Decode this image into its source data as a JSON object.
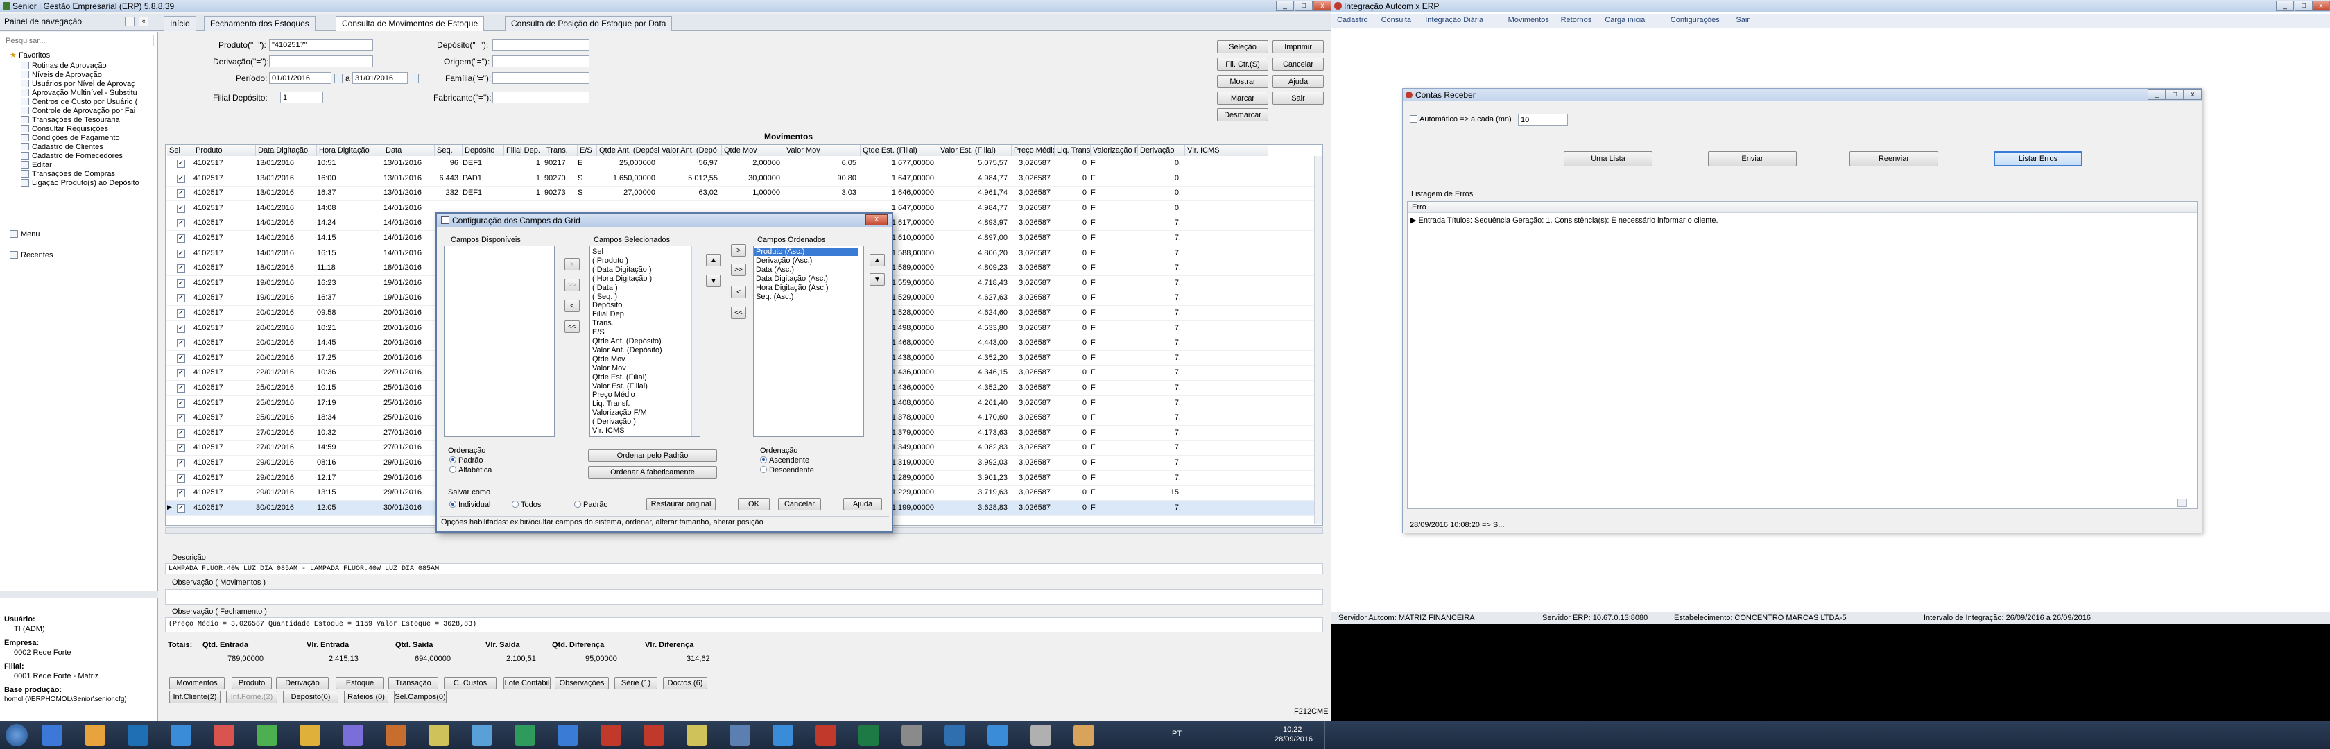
{
  "erp": {
    "title": "Senior | Gestão Empresarial (ERP) 5.8.8.39",
    "nav_panel_label": "Painel de navegação",
    "tabs": [
      "Início",
      "Fechamento dos Estoques",
      "Consulta de Movimentos de Estoque",
      "Consulta de Posição do Estoque por Data"
    ],
    "search_placeholder": "Pesquisar...",
    "favorites_label": "Favoritos",
    "favorites": [
      "Rotinas de Aprovação",
      "Níveis de Aprovação",
      "Usuários por Nível de Aprovaç",
      "Aprovação Multinível - Substitu",
      "Centros de Custo por Usuário (",
      "Controle de Aprovação por Fai",
      "Transações de Tesouraria",
      "Consultar Requisições",
      "Condições de Pagamento",
      "Cadastro de Clientes",
      "Cadastro de Fornecedores",
      "Editar",
      "Transações de Compras",
      "Ligação Produto(s) ao Depósito"
    ],
    "menu_label": "Menu",
    "recentes_label": "Recentes",
    "user_info": {
      "usuario_label": "Usuário:",
      "usuario": "TI (ADM)",
      "empresa_label": "Empresa:",
      "empresa": "0002 Rede Forte",
      "filial_label": "Filial:",
      "filial": "0001 Rede Forte - Matriz",
      "base_label": "Base produção:",
      "base": "homol (\\\\ERPHOMOL\\Senior\\senior.cfg)"
    },
    "filters": {
      "produto_label": "Produto(\"=\"):",
      "produto_value": "\"4102517\"",
      "derivacao_label": "Derivação(\"=\"):",
      "derivacao_value": "",
      "periodo_label": "Período:",
      "periodo_from": "01/01/2016",
      "periodo_sep": "a",
      "periodo_to": "31/01/2016",
      "filial_label": "Filial Depósito:",
      "filial_value": "1",
      "deposito_label": "Depósito(\"=\"):",
      "origem_label": "Origem(\"=\"):",
      "familia_label": "Família(\"=\"):",
      "fabricante_label": "Fabricante(\"=\"):"
    },
    "action_buttons": [
      "Seleção",
      "Imprimir",
      "Fil. Ctr.(S)",
      "Cancelar",
      "Mostrar",
      "Ajuda",
      "Marcar",
      "Sair",
      "Desmarcar"
    ],
    "movimentos_title": "Movimentos",
    "grid_headers": [
      "Sel",
      "Produto",
      "Data Digitação",
      "Hora Digitação",
      "Data",
      "Seq.",
      "Depósito",
      "Filial Dep.",
      "Trans.",
      "E/S",
      "Qtde Ant. (Depósito)",
      "Valor Ant. (Depó",
      "Qtde Mov",
      "Valor Mov",
      "Qtde Est. (Filial)",
      "Valor Est. (Filial)",
      "Preço Médio",
      "Liq. Transf.",
      "Valorização F/M",
      "Derivação",
      "Vlr. ICMS"
    ],
    "grid_rows": [
      [
        "4102517",
        "13/01/2016",
        "10:51",
        "13/01/2016",
        "96",
        "DEF1",
        "1",
        "90217",
        "E",
        "25,000000",
        "56,97",
        "2,00000",
        "6,05",
        "1.677,00000",
        "5.075,57",
        "3,026587",
        "0",
        "F",
        "0,"
      ],
      [
        "4102517",
        "13/01/2016",
        "16:00",
        "13/01/2016",
        "6.443",
        "PAD1",
        "1",
        "90270",
        "S",
        "1.650,00000",
        "5.012,55",
        "30,00000",
        "90,80",
        "1.647,00000",
        "4.984,77",
        "3,026587",
        "0",
        "F",
        "0,"
      ],
      [
        "4102517",
        "13/01/2016",
        "16:37",
        "13/01/2016",
        "232",
        "DEF1",
        "1",
        "90273",
        "S",
        "27,00000",
        "63,02",
        "1,00000",
        "3,03",
        "1.646,00000",
        "4.961,74",
        "3,026587",
        "0",
        "F",
        "0,"
      ],
      [
        "4102517",
        "14/01/2016",
        "14:08",
        "14/01/2016",
        "",
        "",
        "",
        "",
        "",
        "",
        "",
        "",
        "",
        "1.647,00000",
        "4.984,77",
        "3,026587",
        "0",
        "F",
        "0,"
      ],
      [
        "4102517",
        "14/01/2016",
        "14:24",
        "14/01/2016",
        "",
        "",
        "",
        "",
        "",
        "",
        "",
        "",
        "",
        "1.617,00000",
        "4.893,97",
        "3,026587",
        "0",
        "F",
        "7,"
      ],
      [
        "4102517",
        "14/01/2016",
        "14:15",
        "14/01/2016",
        "",
        "",
        "",
        "",
        "",
        "",
        "",
        "",
        "",
        "1.610,00000",
        "4.897,00",
        "3,026587",
        "0",
        "F",
        "7,"
      ],
      [
        "4102517",
        "14/01/2016",
        "16:15",
        "14/01/2016",
        "",
        "",
        "",
        "",
        "",
        "",
        "",
        "",
        "",
        "1.588,00000",
        "4.806,20",
        "3,026587",
        "0",
        "F",
        "7,"
      ],
      [
        "4102517",
        "18/01/2016",
        "11:18",
        "18/01/2016",
        "",
        "",
        "",
        "",
        "",
        "",
        "",
        "",
        "",
        "1.589,00000",
        "4.809,23",
        "3,026587",
        "0",
        "F",
        "7,"
      ],
      [
        "4102517",
        "19/01/2016",
        "16:23",
        "19/01/2016",
        "",
        "",
        "",
        "",
        "",
        "",
        "",
        "",
        "",
        "1.559,00000",
        "4.718,43",
        "3,026587",
        "0",
        "F",
        "7,"
      ],
      [
        "4102517",
        "19/01/2016",
        "16:37",
        "19/01/2016",
        "",
        "",
        "",
        "",
        "",
        "",
        "",
        "",
        "",
        "1.529,00000",
        "4.627,63",
        "3,026587",
        "0",
        "F",
        "7,"
      ],
      [
        "4102517",
        "20/01/2016",
        "09:58",
        "20/01/2016",
        "",
        "",
        "",
        "",
        "",
        "",
        "",
        "",
        "",
        "1.528,00000",
        "4.624,60",
        "3,026587",
        "0",
        "F",
        "7,"
      ],
      [
        "4102517",
        "20/01/2016",
        "10:21",
        "20/01/2016",
        "",
        "",
        "",
        "",
        "",
        "",
        "",
        "",
        "",
        "1.498,00000",
        "4.533,80",
        "3,026587",
        "0",
        "F",
        "7,"
      ],
      [
        "4102517",
        "20/01/2016",
        "14:45",
        "20/01/2016",
        "",
        "",
        "",
        "",
        "",
        "",
        "",
        "",
        "",
        "1.468,00000",
        "4.443,00",
        "3,026587",
        "0",
        "F",
        "7,"
      ],
      [
        "4102517",
        "20/01/2016",
        "17:25",
        "20/01/2016",
        "",
        "",
        "",
        "",
        "",
        "",
        "",
        "",
        "",
        "1.438,00000",
        "4.352,20",
        "3,026587",
        "0",
        "F",
        "7,"
      ],
      [
        "4102517",
        "22/01/2016",
        "10:36",
        "22/01/2016",
        "",
        "",
        "",
        "",
        "",
        "",
        "",
        "",
        "",
        "1.436,00000",
        "4.346,15",
        "3,026587",
        "0",
        "F",
        "7,"
      ],
      [
        "4102517",
        "25/01/2016",
        "10:15",
        "25/01/2016",
        "",
        "",
        "",
        "",
        "",
        "",
        "",
        "",
        "",
        "1.436,00000",
        "4.352,20",
        "3,026587",
        "0",
        "F",
        "7,"
      ],
      [
        "4102517",
        "25/01/2016",
        "17:19",
        "25/01/2016",
        "",
        "",
        "",
        "",
        "",
        "",
        "",
        "",
        "",
        "1.408,00000",
        "4.261,40",
        "3,026587",
        "0",
        "F",
        "7,"
      ],
      [
        "4102517",
        "25/01/2016",
        "18:34",
        "25/01/2016",
        "",
        "",
        "",
        "",
        "",
        "",
        "",
        "",
        "",
        "1.378,00000",
        "4.170,60",
        "3,026587",
        "0",
        "F",
        "7,"
      ],
      [
        "4102517",
        "27/01/2016",
        "10:32",
        "27/01/2016",
        "",
        "",
        "",
        "",
        "",
        "",
        "",
        "",
        "",
        "1.379,00000",
        "4.173,63",
        "3,026587",
        "0",
        "F",
        "7,"
      ],
      [
        "4102517",
        "27/01/2016",
        "14:59",
        "27/01/2016",
        "",
        "",
        "",
        "",
        "",
        "",
        "",
        "",
        "",
        "1.349,00000",
        "4.082,83",
        "3,026587",
        "0",
        "F",
        "7,"
      ],
      [
        "4102517",
        "29/01/2016",
        "08:16",
        "29/01/2016",
        "",
        "",
        "",
        "",
        "",
        "",
        "",
        "",
        "",
        "1.319,00000",
        "3.992,03",
        "3,026587",
        "0",
        "F",
        "7,"
      ],
      [
        "4102517",
        "29/01/2016",
        "12:17",
        "29/01/2016",
        "",
        "",
        "",
        "",
        "",
        "",
        "",
        "",
        "",
        "1.289,00000",
        "3.901,23",
        "3,026587",
        "0",
        "F",
        "7,"
      ],
      [
        "4102517",
        "29/01/2016",
        "13:15",
        "29/01/2016",
        "",
        "",
        "",
        "",
        "",
        "",
        "",
        "",
        "",
        "1.229,00000",
        "3.719,63",
        "3,026587",
        "0",
        "F",
        "15,"
      ],
      [
        "4102517",
        "30/01/2016",
        "12:05",
        "30/01/2016",
        "",
        "",
        "",
        "",
        "",
        "",
        "",
        "",
        "",
        "1.199,00000",
        "3.628,83",
        "3,026587",
        "0",
        "F",
        "7,"
      ]
    ],
    "descricao_label": "Descrição",
    "descricao": "LAMPADA FLUOR.40W LUZ DIA 085AM - LAMPADA FLUOR.40W LUZ DIA 085AM",
    "obs_mov_label": "Observação ( Movimentos )",
    "obs_fech_label": "Observação ( Fechamento )",
    "obs_fech": "(Preço Médio = 3,026587 Quantidade Estoque = 1159 Valor Estoque = 3628,83)",
    "totals": {
      "label": "Totais:",
      "qtd_entrada_label": "Qtd. Entrada",
      "qtd_entrada": "789,00000",
      "vlr_entrada_label": "Vlr. Entrada",
      "vlr_entrada": "2.415,13",
      "qtd_saida_label": "Qtd. Saída",
      "qtd_saida": "694,00000",
      "vlr_saida_label": "Vlr. Saída",
      "vlr_saida": "2.100,51",
      "qtd_dif_label": "Qtd. Diferença",
      "qtd_dif": "95,00000",
      "vlr_dif_label": "Vlr. Diferença",
      "vlr_dif": "314,62"
    },
    "bottom_buttons": [
      "Movimentos",
      "Produto",
      "Derivação",
      "Estoque",
      "Transação",
      "C. Custos",
      "Lote Contábil",
      "Observações",
      "Série (1)",
      "Doctos (6)"
    ],
    "bottom_buttons2": [
      "Inf.Cliente(2)",
      "Inf.Forne.(2)",
      "Depósito(0)",
      "Rateios (0)",
      "Sel.Campos(0)"
    ],
    "status_code": "F212CME"
  },
  "dialog": {
    "title": "Configuração dos Campos da Grid",
    "disponiveis_label": "Campos Disponíveis",
    "selecionados_label": "Campos Selecionados",
    "ordenados_label": "Campos Ordenados",
    "selecionados": [
      "Sel",
      "( Produto )",
      "( Data Digitação )",
      "( Hora Digitação )",
      "( Data )",
      "( Seq. )",
      "Depósito",
      "Filial Dep.",
      "Trans.",
      "E/S",
      "Qtde Ant. (Depósito)",
      "Valor Ant. (Depósito)",
      "Qtde Mov",
      "Valor Mov",
      "Qtde Est. (Filial)",
      "Valor Est. (Filial)",
      "Preço Médio",
      "Liq. Transf.",
      "Valorização F/M",
      "( Derivação )",
      "Vlr. ICMS"
    ],
    "ordenados": [
      "Produto (Asc.)",
      "Derivação (Asc.)",
      "Data (Asc.)",
      "Data Digitação (Asc.)",
      "Hora Digitação (Asc.)",
      "Seq. (Asc.)"
    ],
    "ordenacao_label": "Ordenação",
    "ordenacao_opts": [
      "Padrão",
      "Alfabética"
    ],
    "ordenar_padrao": "Ordenar pelo Padrão",
    "ordenar_alfa": "Ordenar Alfabeticamente",
    "ordenacao2_label": "Ordenação",
    "ordenacao2_opts": [
      "Ascendente",
      "Descendente"
    ],
    "salvar_label": "Salvar como",
    "salvar_opts": [
      "Individual",
      "Todos",
      "Padrão"
    ],
    "restaurar": "Restaurar original",
    "ok": "OK",
    "cancelar": "Cancelar",
    "ajuda": "Ajuda",
    "status": "Opções habilitadas: exibir/ocultar campos do sistema, ordenar, alterar tamanho, alterar posição"
  },
  "integ": {
    "title": "Integração Autcom x ERP",
    "menu": [
      "Cadastro",
      "Consulta",
      "Integração Diária",
      "Movimentos",
      "Retornos",
      "Carga inicial",
      "Configurações",
      "Sair"
    ],
    "contas_title": "Contas Receber",
    "auto_label": "Automático => a cada (mn)",
    "auto_value": "10",
    "buttons": [
      "Uma Lista",
      "Enviar",
      "Reenviar",
      "Listar Erros"
    ],
    "listagem_label": "Listagem de Erros",
    "erro_header": "Erro",
    "erro_row": "Entrada Títulos: Sequência Geração: 1. Consistência(s): É necessário informar o cliente.",
    "status_time": "28/09/2016 10:08:20 => S...",
    "footer": [
      "Servidor Autcom: MATRIZ FINANCEIRA",
      "Servidor ERP: 10.67.0.13:8080",
      "Estabelecimento: CONCENTRO MARCAS LTDA-5",
      "Intervalo de Integração: 26/09/2016 a 26/09/2016"
    ]
  },
  "taskbar": {
    "lang": "PT",
    "time": "10:22",
    "date": "28/09/2016"
  }
}
